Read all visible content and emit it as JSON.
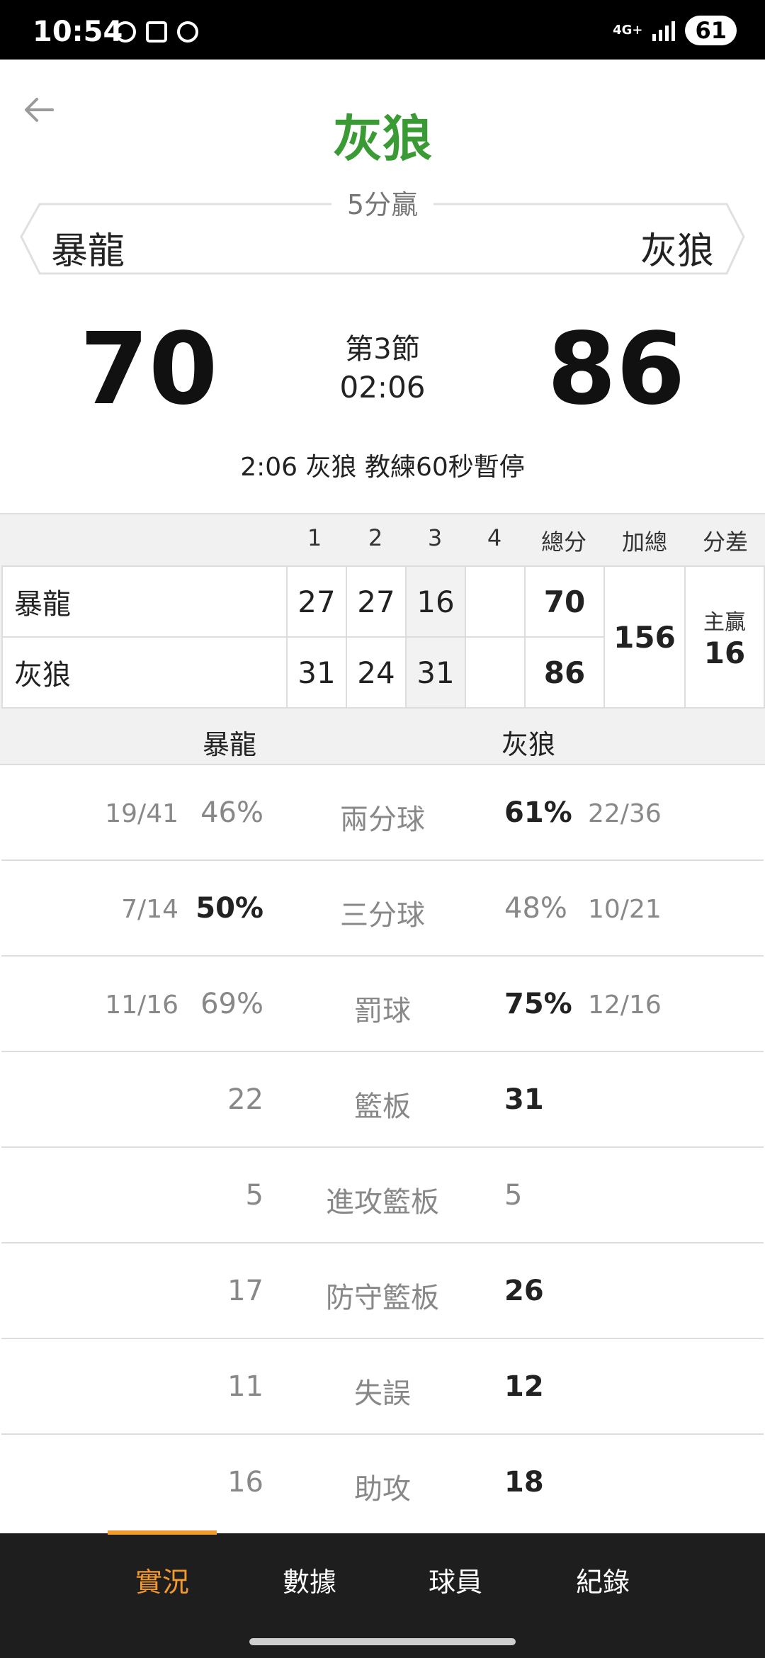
{
  "status_bar": {
    "time": "10:54",
    "network": "4G+",
    "battery": "61"
  },
  "header": {
    "winner": "灰狼",
    "margin": "5分贏",
    "away_team": "暴龍",
    "home_team": "灰狼"
  },
  "score": {
    "away": "70",
    "home": "86",
    "period": "第3節",
    "clock": "02:06"
  },
  "event": "2:06 灰狼  教練60秒暫停",
  "box_score": {
    "headers": {
      "q1": "1",
      "q2": "2",
      "q3": "3",
      "q4": "4",
      "total": "總分",
      "sum": "加總",
      "diff": "分差"
    },
    "rows": [
      {
        "team": "暴龍",
        "q1": "27",
        "q2": "27",
        "q3": "16",
        "q4": "",
        "total": "70"
      },
      {
        "team": "灰狼",
        "q1": "31",
        "q2": "24",
        "q3": "31",
        "q4": "",
        "total": "86"
      }
    ],
    "sum": "156",
    "diff_label": "主贏",
    "diff_value": "16"
  },
  "stats": {
    "away_team": "暴龍",
    "home_team": "灰狼",
    "rows": [
      {
        "label": "兩分球",
        "away_frac": "19/41",
        "away_val": "46%",
        "home_val": "61%",
        "home_frac": "22/36"
      },
      {
        "label": "三分球",
        "away_frac": "7/14",
        "away_val": "50%",
        "home_val": "48%",
        "home_frac": "10/21"
      },
      {
        "label": "罰球",
        "away_frac": "11/16",
        "away_val": "69%",
        "home_val": "75%",
        "home_frac": "12/16"
      },
      {
        "label": "籃板",
        "away_frac": "",
        "away_val": "22",
        "home_val": "31",
        "home_frac": ""
      },
      {
        "label": "進攻籃板",
        "away_frac": "",
        "away_val": "5",
        "home_val": "5",
        "home_frac": ""
      },
      {
        "label": "防守籃板",
        "away_frac": "",
        "away_val": "17",
        "home_val": "26",
        "home_frac": ""
      },
      {
        "label": "失誤",
        "away_frac": "",
        "away_val": "11",
        "home_val": "12",
        "home_frac": ""
      },
      {
        "label": "助攻",
        "away_frac": "",
        "away_val": "16",
        "home_val": "18",
        "home_frac": ""
      }
    ]
  },
  "bottom_nav": [
    {
      "label": "實況"
    },
    {
      "label": "數據"
    },
    {
      "label": "球員"
    },
    {
      "label": "紀錄"
    }
  ],
  "colors": {
    "winner_green": "#3a9b35",
    "accent_orange": "#f29a2e",
    "nav_bg": "#1e1e1e"
  }
}
